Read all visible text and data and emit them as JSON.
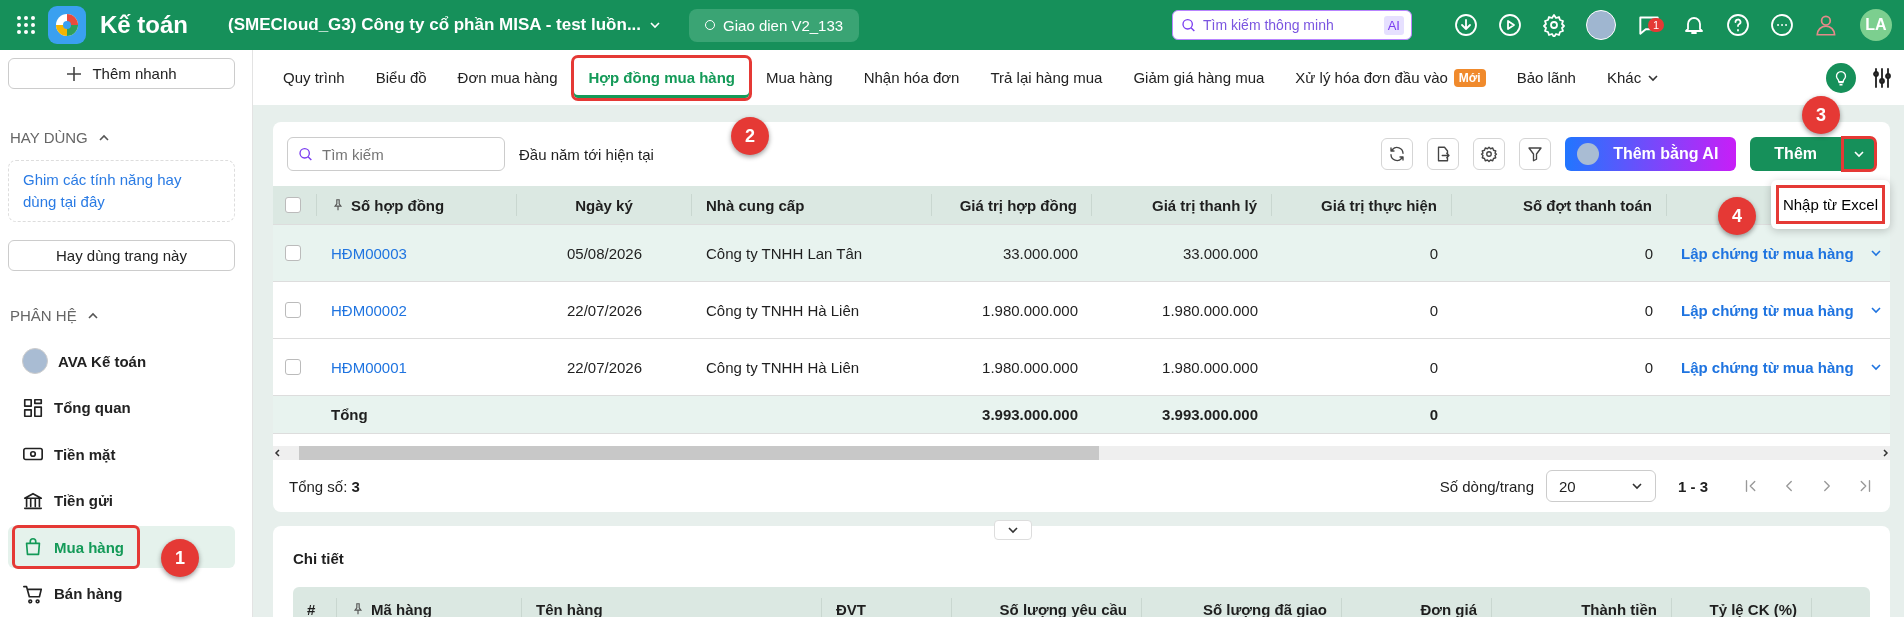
{
  "topbar": {
    "title": "Kế toán",
    "company": "(SMECloud_G3) Công ty cổ phần MISA - test luồn...",
    "version_badge": "Giao dien V2_133",
    "search": {
      "placeholder": "Tìm kiếm thông minh",
      "badge": "AI"
    },
    "chat_count": "1",
    "avatar_initials": "LA"
  },
  "sidebar": {
    "quick_add": "Thêm nhanh",
    "favorites": {
      "title": "HAY DÙNG",
      "expanded": true,
      "hint": "Ghim các tính năng hay dùng tại đây",
      "pin_button": "Hay dùng trang này"
    },
    "modules": {
      "title": "PHÂN HỆ",
      "expanded": true,
      "items": [
        {
          "label": "AVA Kế toán",
          "selected": false,
          "highlighted": false
        },
        {
          "label": "Tổng quan",
          "selected": false,
          "highlighted": false
        },
        {
          "label": "Tiền mặt",
          "selected": false,
          "highlighted": false
        },
        {
          "label": "Tiền gửi",
          "selected": false,
          "highlighted": false
        },
        {
          "label": "Mua hàng",
          "selected": true,
          "highlighted": true
        },
        {
          "label": "Bán hàng",
          "selected": false,
          "highlighted": false
        }
      ]
    }
  },
  "tabs": [
    {
      "label": "Quy trình",
      "kind": "tab",
      "selected": false,
      "highlighted": false
    },
    {
      "label": "Biểu đồ",
      "kind": "tab",
      "selected": false,
      "highlighted": false
    },
    {
      "label": "Đơn mua hàng",
      "kind": "tab",
      "selected": false,
      "highlighted": false
    },
    {
      "label": "Hợp đồng mua hàng",
      "kind": "tab",
      "selected": true,
      "highlighted": true
    },
    {
      "label": "Mua hàng",
      "kind": "tab",
      "selected": false,
      "highlighted": false
    },
    {
      "label": "Nhận hóa đơn",
      "kind": "tab",
      "selected": false,
      "highlighted": false
    },
    {
      "label": "Trả lại hàng mua",
      "kind": "tab",
      "selected": false,
      "highlighted": false
    },
    {
      "label": "Giảm giá hàng mua",
      "kind": "tab",
      "selected": false,
      "highlighted": false
    },
    {
      "label": "Xử lý hóa đơn đầu vào",
      "kind": "tab",
      "badge": "Mới",
      "selected": false,
      "highlighted": false
    },
    {
      "label": "Bảo lãnh",
      "kind": "tab",
      "selected": false,
      "highlighted": false
    },
    {
      "label": "Khác",
      "kind": "menu",
      "selected": false,
      "highlighted": false
    }
  ],
  "toolbar": {
    "search": {
      "placeholder": "Tìm kiếm"
    },
    "period": "Đầu năm tới hiện tại",
    "ai_button": "Thêm bằng AI",
    "add_button": "Thêm",
    "caret_highlighted": true,
    "dropdown": [
      {
        "label": "Nhập từ Excel",
        "highlighted": true
      }
    ]
  },
  "table": {
    "columns": [
      "Số hợp đồng",
      "Ngày ký",
      "Nhà cung cấp",
      "Giá trị hợp đồng",
      "Giá trị thanh lý",
      "Giá trị thực hiện",
      "Số đợt thanh toán"
    ],
    "rows": [
      {
        "selected": true,
        "checked": false,
        "cells": [
          "HĐM00003",
          "05/08/2026",
          "Công ty TNHH Lan Tân",
          "33.000.000",
          "33.000.000",
          "0",
          "0"
        ],
        "action": "Lập chứng từ mua hàng"
      },
      {
        "selected": false,
        "checked": false,
        "cells": [
          "HĐM00002",
          "22/07/2026",
          "Công ty TNHH Hà Liên",
          "1.980.000.000",
          "1.980.000.000",
          "0",
          "0"
        ],
        "action": "Lập chứng từ mua hàng"
      },
      {
        "selected": false,
        "checked": false,
        "cells": [
          "HĐM00001",
          "22/07/2026",
          "Công ty TNHH Hà Liên",
          "1.980.000.000",
          "1.980.000.000",
          "0",
          "0"
        ],
        "action": "Lập chứng từ mua hàng"
      }
    ],
    "all_checked": false,
    "totals": {
      "label": "Tổng",
      "contract_value": "3.993.000.000",
      "liquidation_value": "3.993.000.000",
      "performed_value": "0"
    }
  },
  "footer": {
    "total_label": "Tổng số:",
    "total_count": "3",
    "page_size_label": "Số dòng/trang",
    "page_size": "20",
    "range": "1 - 3"
  },
  "detail": {
    "title": "Chi tiết",
    "columns": [
      "#",
      "Mã hàng",
      "Tên hàng",
      "ĐVT",
      "Số lượng yêu cầu",
      "Số lượng đã giao",
      "Đơn giá",
      "Thành tiền",
      "Tỷ lệ CK (%)"
    ]
  },
  "annotations": [
    {
      "number": "1"
    },
    {
      "number": "2"
    },
    {
      "number": "3"
    },
    {
      "number": "4"
    }
  ]
}
